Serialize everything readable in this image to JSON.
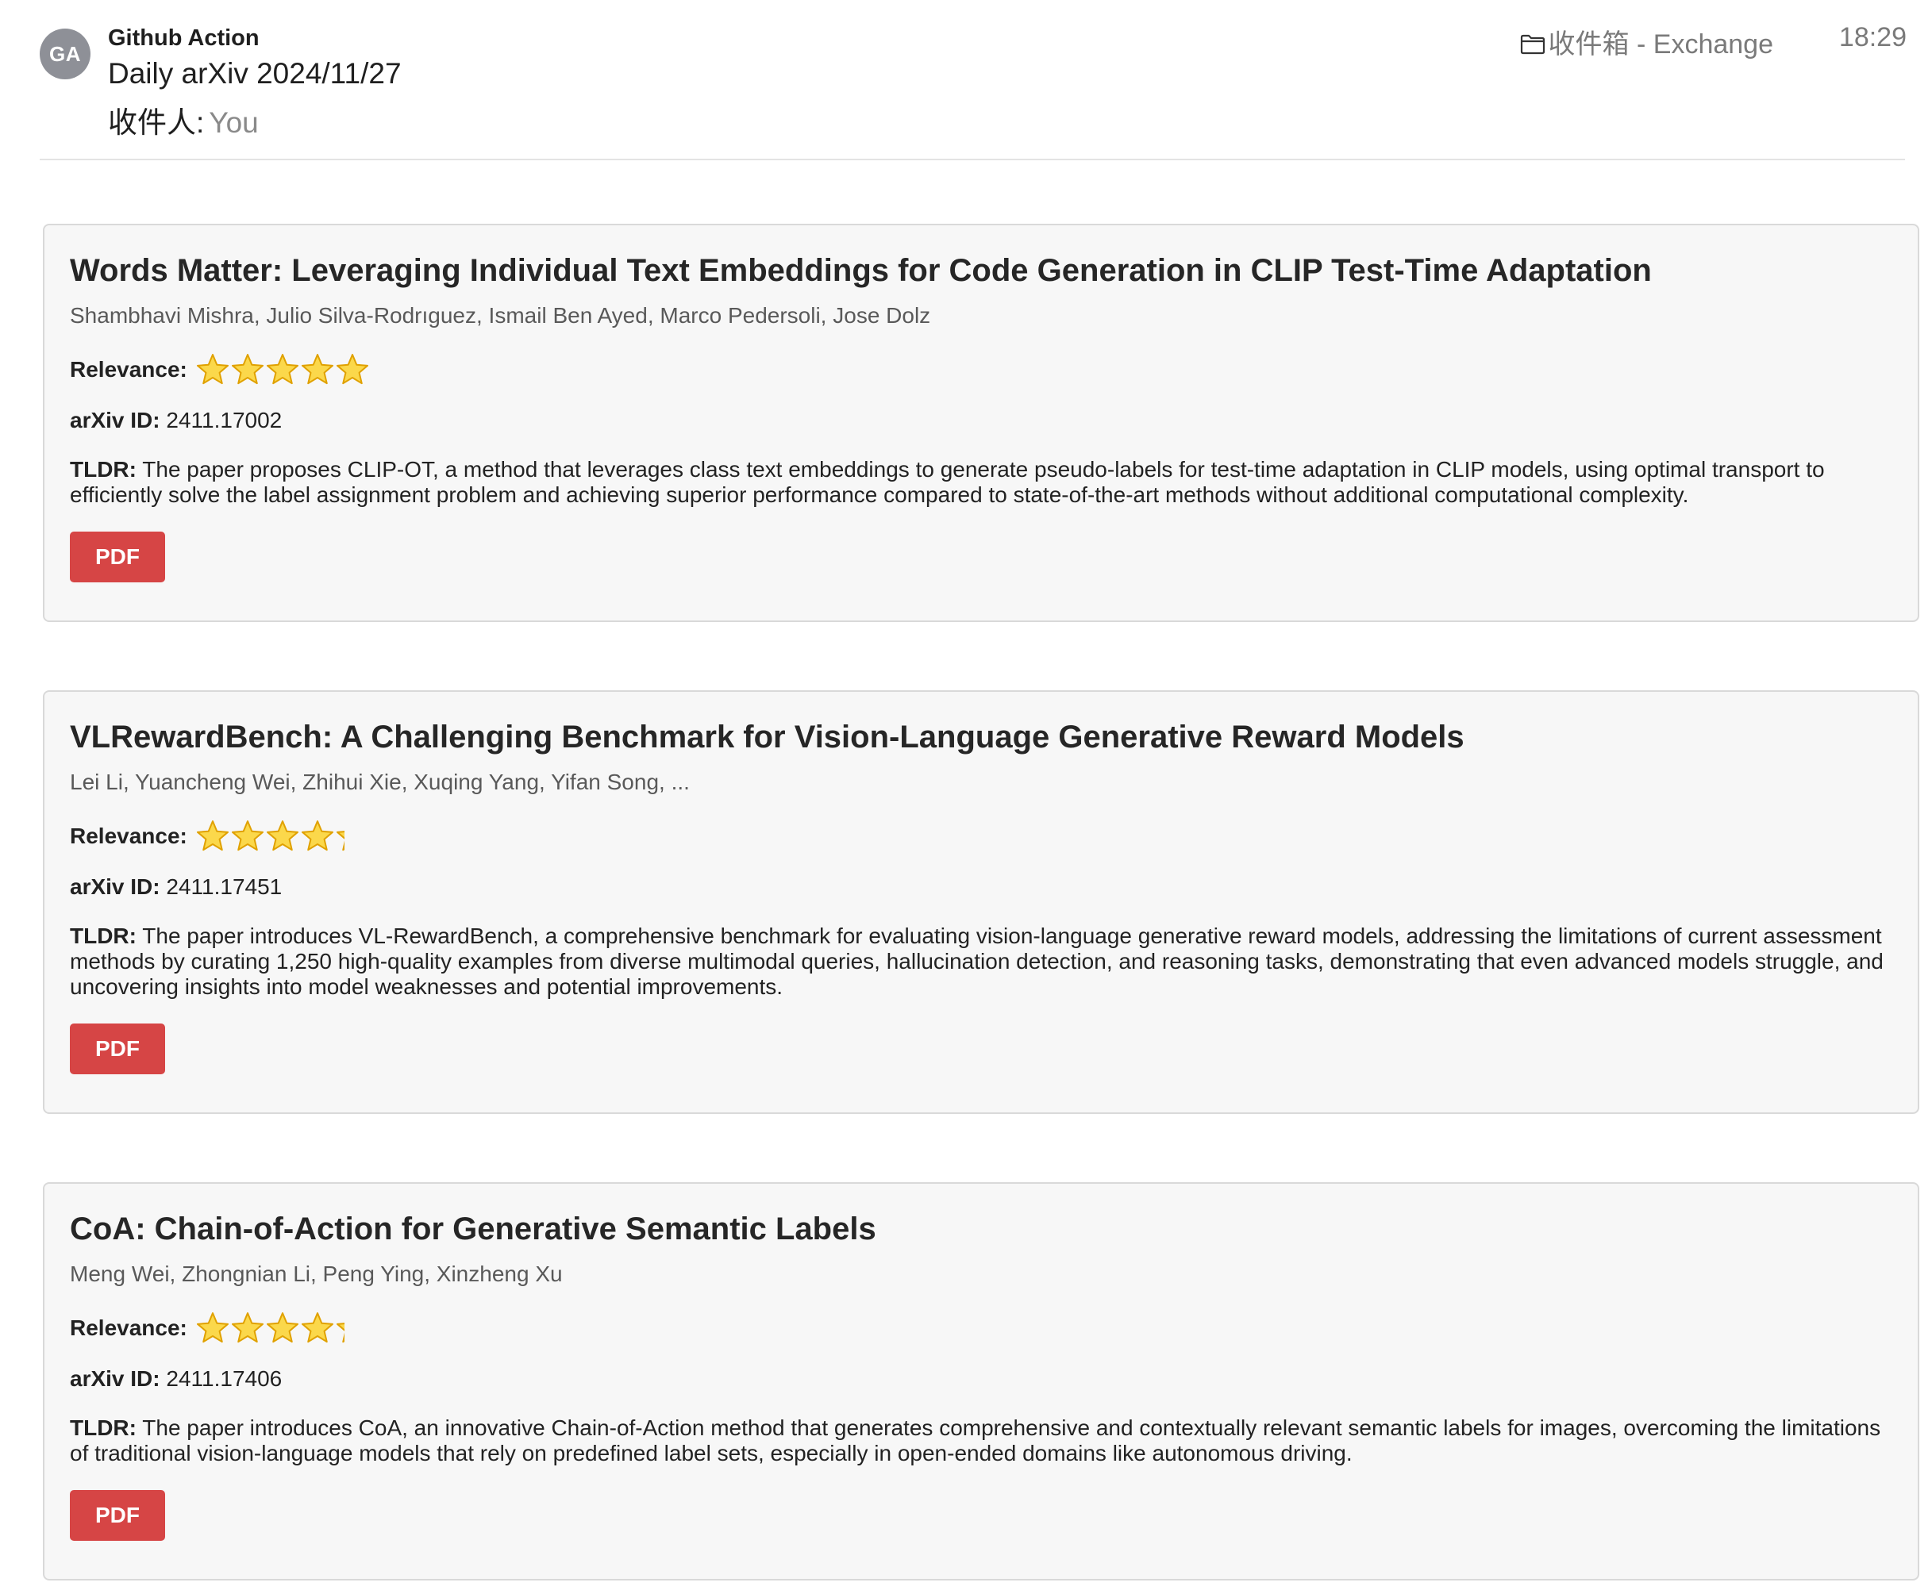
{
  "mail": {
    "avatar_initials": "GA",
    "sender": "Github Action",
    "subject": "Daily arXiv 2024/11/27",
    "recipient_label": "收件人:",
    "recipient_value": "You",
    "folder": "收件箱 - Exchange",
    "time": "18:29",
    "folder_icon": "folder-icon"
  },
  "labels": {
    "relevance": "Relevance:",
    "arxiv_id": "arXiv ID:",
    "tldr": "TLDR:",
    "pdf": "PDF"
  },
  "colors": {
    "pdf_button": "#d64545",
    "card_background": "#f7f7f7",
    "star_fill": "#fbd84b",
    "star_outline": "#e0a100"
  },
  "papers": [
    {
      "title": "Words Matter: Leveraging Individual Text Embeddings for Code Generation in CLIP Test-Time Adaptation",
      "authors": "Shambhavi Mishra, Julio Silva-Rodrıguez, Ismail Ben Ayed, Marco Pedersoli, Jose Dolz",
      "relevance_stars": 5,
      "arxiv_id": "2411.17002",
      "tldr": "The paper proposes CLIP-OT, a method that leverages class text embeddings to generate pseudo-labels for test-time adaptation in CLIP models, using optimal transport to efficiently solve the label assignment problem and achieving superior performance compared to state-of-the-art methods without additional computational complexity."
    },
    {
      "title": "VLRewardBench: A Challenging Benchmark for Vision-Language Generative Reward Models",
      "authors": "Lei Li, Yuancheng Wei, Zhihui Xie, Xuqing Yang, Yifan Song, ...",
      "relevance_stars": 4.5,
      "arxiv_id": "2411.17451",
      "tldr": "The paper introduces VL-RewardBench, a comprehensive benchmark for evaluating vision-language generative reward models, addressing the limitations of current assessment methods by curating 1,250 high-quality examples from diverse multimodal queries, hallucination detection, and reasoning tasks, demonstrating that even advanced models struggle, and uncovering insights into model weaknesses and potential improvements."
    },
    {
      "title": "CoA: Chain-of-Action for Generative Semantic Labels",
      "authors": "Meng Wei, Zhongnian Li, Peng Ying, Xinzheng Xu",
      "relevance_stars": 4.5,
      "arxiv_id": "2411.17406",
      "tldr": "The paper introduces CoA, an innovative Chain-of-Action method that generates comprehensive and contextually relevant semantic labels for images, overcoming the limitations of traditional vision-language models that rely on predefined label sets, especially in open-ended domains like autonomous driving."
    }
  ]
}
